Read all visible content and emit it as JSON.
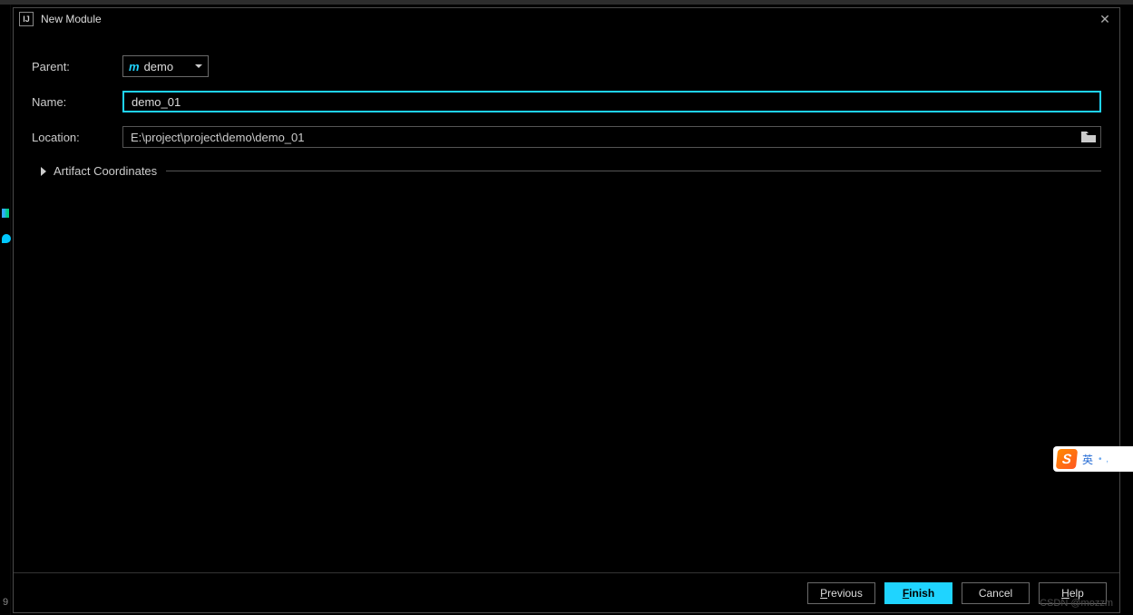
{
  "window": {
    "title": "New Module"
  },
  "form": {
    "parent_label": "Parent:",
    "parent_value": "demo",
    "name_label": "Name:",
    "name_value": "demo_01",
    "location_label": "Location:",
    "location_value": "E:\\project\\project\\demo\\demo_01",
    "artifact_label": "Artifact Coordinates"
  },
  "buttons": {
    "previous": "Previous",
    "previous_accel": "P",
    "finish": "Finish",
    "finish_accel": "F",
    "cancel": "Cancel",
    "help": "Help",
    "help_accel": "H"
  },
  "ime": {
    "logo": "S",
    "lang": "英"
  },
  "watermark": "CSDN @mozzm",
  "left_num": "9"
}
